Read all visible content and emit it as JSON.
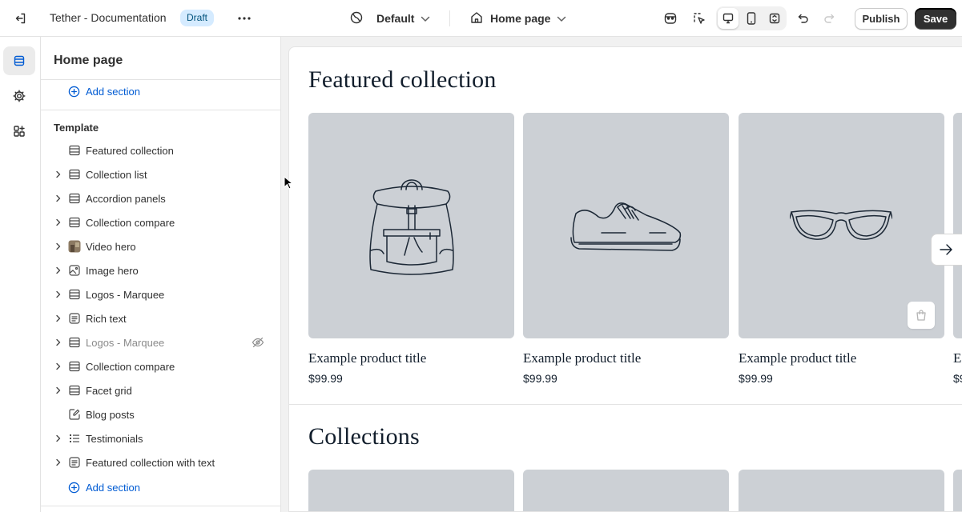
{
  "topbar": {
    "store_title": "Tether - Documentation",
    "status_badge": "Draft",
    "theme_select": "Default",
    "page_select": "Home page",
    "publish_label": "Publish",
    "save_label": "Save"
  },
  "rail": {
    "items": [
      {
        "icon": "sections-icon",
        "active": true
      },
      {
        "icon": "gear-icon",
        "active": false
      },
      {
        "icon": "apps-icon",
        "active": false
      }
    ]
  },
  "panel": {
    "title": "Home page",
    "add_section_label": "Add section",
    "template_heading": "Template",
    "sections": [
      {
        "label": "Featured collection",
        "icon": "section-icon",
        "expandable": false,
        "hidden": false
      },
      {
        "label": "Collection list",
        "icon": "section-icon",
        "expandable": true,
        "hidden": false
      },
      {
        "label": "Accordion panels",
        "icon": "section-icon",
        "expandable": true,
        "hidden": false
      },
      {
        "label": "Collection compare",
        "icon": "section-icon",
        "expandable": true,
        "hidden": false
      },
      {
        "label": "Video hero",
        "icon": "video-thumbnail-icon",
        "expandable": true,
        "hidden": false
      },
      {
        "label": "Image hero",
        "icon": "image-icon",
        "expandable": true,
        "hidden": false
      },
      {
        "label": "Logos - Marquee",
        "icon": "section-icon",
        "expandable": true,
        "hidden": false
      },
      {
        "label": "Rich text",
        "icon": "text-block-icon",
        "expandable": true,
        "hidden": false
      },
      {
        "label": "Logos - Marquee",
        "icon": "section-icon",
        "expandable": true,
        "hidden": true
      },
      {
        "label": "Collection compare",
        "icon": "section-icon",
        "expandable": true,
        "hidden": false
      },
      {
        "label": "Facet grid",
        "icon": "section-icon",
        "expandable": true,
        "hidden": false
      },
      {
        "label": "Blog posts",
        "icon": "blog-icon",
        "expandable": false,
        "hidden": false
      },
      {
        "label": "Testimonials",
        "icon": "list-icon",
        "expandable": true,
        "hidden": false
      },
      {
        "label": "Featured collection with text",
        "icon": "text-block-icon",
        "expandable": true,
        "hidden": false
      }
    ]
  },
  "preview": {
    "featured_title": "Featured collection",
    "products": [
      {
        "title": "Example product title",
        "price": "$99.99",
        "image": "backpack-illustration"
      },
      {
        "title": "Example product title",
        "price": "$99.99",
        "image": "sneaker-illustration"
      },
      {
        "title": "Example product title",
        "price": "$99.99",
        "image": "sunglasses-illustration"
      },
      {
        "title": "E",
        "price": "$9",
        "image": "partial-card"
      }
    ],
    "collections_title": "Collections"
  },
  "colors": {
    "accent": "#005bd3",
    "badge_bg": "#d5ebff",
    "save_bg": "#303030",
    "placeholder_bg": "#ccd0d5",
    "storefront_text": "#121e2c"
  }
}
